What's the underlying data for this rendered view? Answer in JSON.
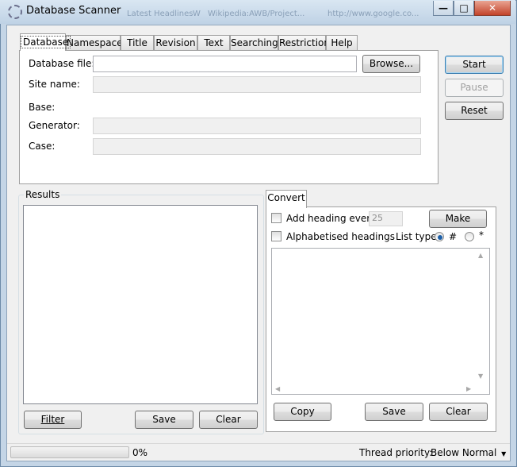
{
  "window": {
    "title": "Database Scanner",
    "ghost_tabs": [
      "Latest Headlines",
      "W",
      "Wikipedia:AWB/Project...",
      "http://www.google.co..."
    ],
    "caption_buttons": {
      "minimize": "—",
      "maximize": "□",
      "close": "✕"
    }
  },
  "tabs": [
    "Database",
    "Namespace",
    "Title",
    "Revision",
    "Text",
    "Searching",
    "Restriction",
    "Help"
  ],
  "database": {
    "file_label": "Database file:",
    "file_value": "",
    "browse_label": "Browse...",
    "site_name_label": "Site name:",
    "base_label": "Base:",
    "generator_label": "Generator:",
    "case_label": "Case:"
  },
  "actions": {
    "start": "Start",
    "pause": "Pause",
    "reset": "Reset"
  },
  "results": {
    "label": "Results",
    "filter": "Filter",
    "save": "Save",
    "clear": "Clear"
  },
  "convert": {
    "tab": "Convert",
    "add_heading_label": "Add heading every",
    "heading_every_value": "25",
    "make": "Make",
    "alphabetised_label": "Alphabetised headings",
    "list_type_label": "List type",
    "list_type_hash": "#",
    "list_type_bullet": "*",
    "copy": "Copy",
    "save": "Save",
    "clear": "Clear"
  },
  "status": {
    "progress_text": "0%",
    "progress_value": 0,
    "thread_priority_label": "Thread priority:",
    "thread_priority_value": "Below Normal"
  },
  "colors": {
    "accent": "#3c7fb1",
    "radio_dot": "#1c5fa8",
    "close": "#c3432a"
  }
}
